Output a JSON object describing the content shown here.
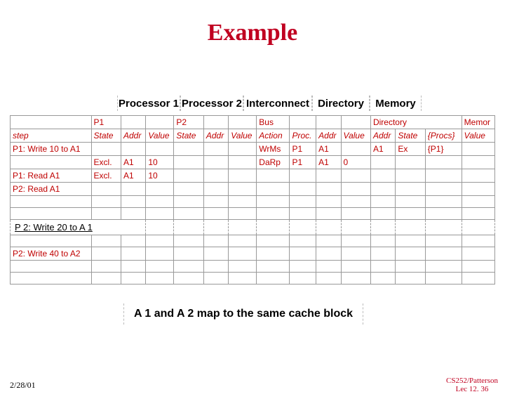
{
  "title": "Example",
  "groups": {
    "p1": "Processor 1",
    "p2": "Processor 2",
    "ic": "Interconnect",
    "dir": "Directory",
    "mem": "Memory"
  },
  "headers": {
    "p1label": "P1",
    "p2label": "P2",
    "buslabel": "Bus",
    "dirlabel": "Directory",
    "memlabel": "Memor",
    "step": "step",
    "state": "State",
    "addr": "Addr",
    "value": "Value",
    "action": "Action",
    "proc": "Proc.",
    "procs": "{Procs}"
  },
  "rows": {
    "r1": {
      "step": "P1: Write 10 to A1",
      "act": "WrMs",
      "bproc": "P1",
      "baddr": "A1",
      "daddr": "A1",
      "dstate": "Ex",
      "dprocs": "{P1}"
    },
    "r2": {
      "p1state": "Excl.",
      "p1addr": "A1",
      "p1val": "10",
      "act": "DaRp",
      "bproc": "P1",
      "baddr": "A1",
      "bval": "0"
    },
    "r3": {
      "step": "P1: Read A1",
      "p1state": "Excl.",
      "p1addr": "A1",
      "p1val": "10"
    },
    "r4": {
      "step": "P2: Read A1"
    },
    "hl": {
      "step": "P 2: Write 20 to A 1"
    },
    "r7": {
      "step": "P2: Write 40 to A2"
    }
  },
  "caption": "A 1 and A 2 map to the same cache block",
  "footer": {
    "date": "2/28/01",
    "course": "CS252/Patterson",
    "lec": "Lec 12. 36"
  }
}
